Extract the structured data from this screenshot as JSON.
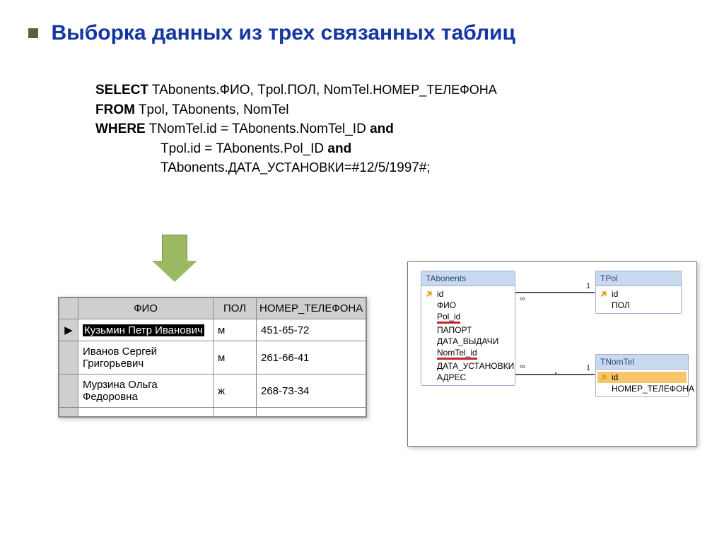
{
  "title": "Выборка данных из трех связанных таблиц",
  "sql": {
    "kw_select": "SELECT",
    "select_cols": " TAbonents.ФИО, Tpol.ПОЛ, NomTel.",
    "select_cols2": "НОМЕР_ТЕЛЕФОНА",
    "kw_from": "FROM",
    "from_tables": " Tpol, TAbonents, NomTel",
    "kw_where": "WHERE",
    "where1a": " TNomTel.id = TAbonents.NomTel_ID ",
    "kw_and1": "and",
    "where2a": "Tpol.id = TAbonents.Pol_ID ",
    "kw_and2": "and",
    "where3a": "TAbonents.",
    "where3b": "ДАТА_УСТАНОВКИ",
    "where3c": "=#12/5/1997#;"
  },
  "result": {
    "cols": [
      "ФИО",
      "ПОЛ",
      "НОМЕР_ТЕЛЕФОНА"
    ],
    "rows": [
      {
        "fio": "Кузьмин Петр Иванович",
        "pol": "м",
        "tel": "451-65-72",
        "selected": true,
        "marker": "▶"
      },
      {
        "fio": "Иванов Сергей Григорьевич",
        "pol": "м",
        "tel": "261-66-41",
        "selected": false,
        "marker": ""
      },
      {
        "fio": "Мурзина Ольга Федоровна",
        "pol": "ж",
        "tel": "268-73-34",
        "selected": false,
        "marker": ""
      }
    ]
  },
  "schema": {
    "tabonents": {
      "name": "TAbonents",
      "fields": [
        "id",
        "ФИО",
        "Pol_id",
        "ПАПОРТ",
        "ДАТА_ВЫДАЧИ",
        "NomTel_id",
        "ДАТА_УСТАНОВКИ",
        "АДРЕС"
      ]
    },
    "tpol": {
      "name": "TPol",
      "fields": [
        "id",
        "ПОЛ"
      ]
    },
    "tnomtel": {
      "name": "TNomTel",
      "fields": [
        "id",
        "НОМЕР_ТЕЛЕФОНА"
      ]
    },
    "rel_labels": {
      "one": "1",
      "many": "∞"
    }
  }
}
